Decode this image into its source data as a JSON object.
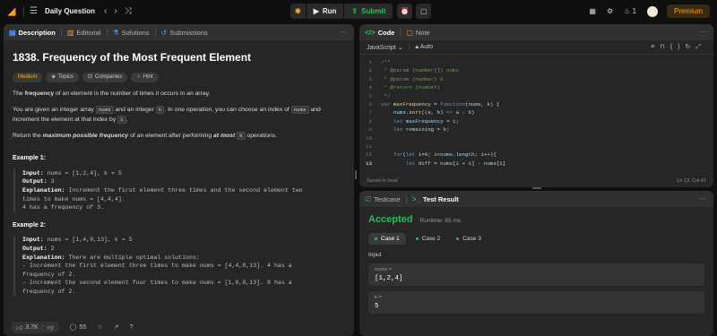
{
  "topbar": {
    "title": "Daily Question",
    "run_label": "Run",
    "submit_label": "Submit",
    "notification_count": "1",
    "premium_label": "Premium"
  },
  "left_tabs": {
    "description": "Description",
    "editorial": "Editorial",
    "solutions": "Solutions",
    "submissions": "Submissions"
  },
  "problem": {
    "title": "1838. Frequency of the Most Frequent Element",
    "difficulty": "Medium",
    "chips": [
      "Topics",
      "Companies",
      "Hint"
    ],
    "p1_pre": "The ",
    "p1_bold": "frequency",
    "p1_post": " of an element is the number of times it occurs in an array.",
    "p2_a": "You are given an integer array ",
    "p2_code1": "nums",
    "p2_b": " and an integer ",
    "p2_code2": "k",
    "p2_c": ". In one operation, you can choose an index of ",
    "p2_code3": "nums",
    "p2_d": " and increment the element at that index by ",
    "p2_code4": "1",
    "p2_e": ".",
    "p3_a": "Return the ",
    "p3_bold1": "maximum possible frequency",
    "p3_b": " of an element after performing ",
    "p3_bold2": "at most",
    "p3_code": "k",
    "p3_c": " operations.",
    "examples": [
      {
        "title": "Example 1:",
        "input": "nums = [1,2,4], k = 5",
        "output": "3",
        "explanation_lines": [
          "Increment the first element three times and the second element two",
          "times to make nums = [4,4,4].",
          "4 has a frequency of 3."
        ]
      },
      {
        "title": "Example 2:",
        "input": "nums = [1,4,8,13], k = 5",
        "output": "2",
        "explanation_lines": [
          "There are multiple optimal solutions:",
          "- Increment the first element three times to make nums = [4,4,8,13]. 4 has a",
          "frequency of 2.",
          "- Increment the second element four times to make nums = [1,8,8,13]. 8 has a",
          "frequency of 2."
        ]
      }
    ]
  },
  "footer": {
    "likes": "3.7K",
    "comments": "55"
  },
  "code_panel": {
    "tab_code": "Code",
    "tab_note": "Note",
    "language": "JavaScript",
    "auto": "Auto",
    "saved": "Saved to local",
    "cursor": "Ln 13, Col 41",
    "lines": [
      {
        "n": "1",
        "html": "<span class='cm'>/**</span>"
      },
      {
        "n": "2",
        "html": "<span class='cm'> * @param {number[]} nums</span>"
      },
      {
        "n": "3",
        "html": "<span class='cm'> * @param {number} k</span>"
      },
      {
        "n": "4",
        "html": "<span class='cm'> * @return {number}</span>"
      },
      {
        "n": "5",
        "html": "<span class='cm'> */</span>"
      },
      {
        "n": "6",
        "html": "<span class='kw'>var</span> <span class='fn'>maxFrequency</span> <span class='tx'>=</span> <span class='kw'>function</span><span class='tx'>(</span><span class='vr'>nums</span><span class='tx'>, </span><span class='vr'>k</span><span class='tx'>) {</span>"
      },
      {
        "n": "7",
        "html": "    <span class='vr'>nums</span><span class='tx'>.</span><span class='fn'>sort</span><span class='tx'>((</span><span class='vr'>a</span><span class='tx'>, </span><span class='vr'>b</span><span class='tx'>) </span><span class='kw'>=&gt;</span> <span class='vr'>a</span> <span class='tx'>-</span> <span class='vr'>b</span><span class='tx'>)</span>"
      },
      {
        "n": "8",
        "html": "    <span class='kw'>let</span> <span class='vr'>maxFrequency</span> <span class='tx'>=</span> <span class='nm'>1</span><span class='tx'>;</span>"
      },
      {
        "n": "9",
        "html": "    <span class='kw'>let</span> <span class='vr'>remaining</span> <span class='tx'>=</span> <span class='vr'>k</span><span class='tx'>;</span>"
      },
      {
        "n": "10",
        "html": ""
      },
      {
        "n": "11",
        "html": ""
      },
      {
        "n": "12",
        "html": "    <span class='kw'>for</span><span class='tx'>(</span><span class='kw'>let</span> <span class='vr'>i</span><span class='tx'>=</span><span class='nm'>0</span><span class='tx'>; </span><span class='vr'>i</span><span class='tx'>&lt;</span><span class='vr'>nums</span><span class='tx'>.</span><span class='vr'>length</span><span class='tx'>; </span><span class='vr'>i</span><span class='tx'>++){</span>"
      },
      {
        "n": "13",
        "html": "        <span class='kw'>let</span> <span class='vr'>diff</span> <span class='tx'>=</span> <span class='vr'>nums</span><span class='tx'>[</span><span class='vr'>i</span> <span class='tx'>+</span> <span class='nm'>1</span><span class='tx'>] -</span> <span class='vr'>nums</span><span class='tx'>[</span><span class='vr'>i</span><span class='tx'>]</span>"
      }
    ]
  },
  "result_panel": {
    "tab_testcase": "Testcase",
    "tab_result": "Test Result",
    "status": "Accepted",
    "runtime": "Runtime: 65 ms",
    "cases": [
      "Case 1",
      "Case 2",
      "Case 3"
    ],
    "input_label": "Input",
    "vars": [
      {
        "name": "nums =",
        "value": "[1,2,4]"
      },
      {
        "name": "k =",
        "value": "5"
      }
    ]
  }
}
